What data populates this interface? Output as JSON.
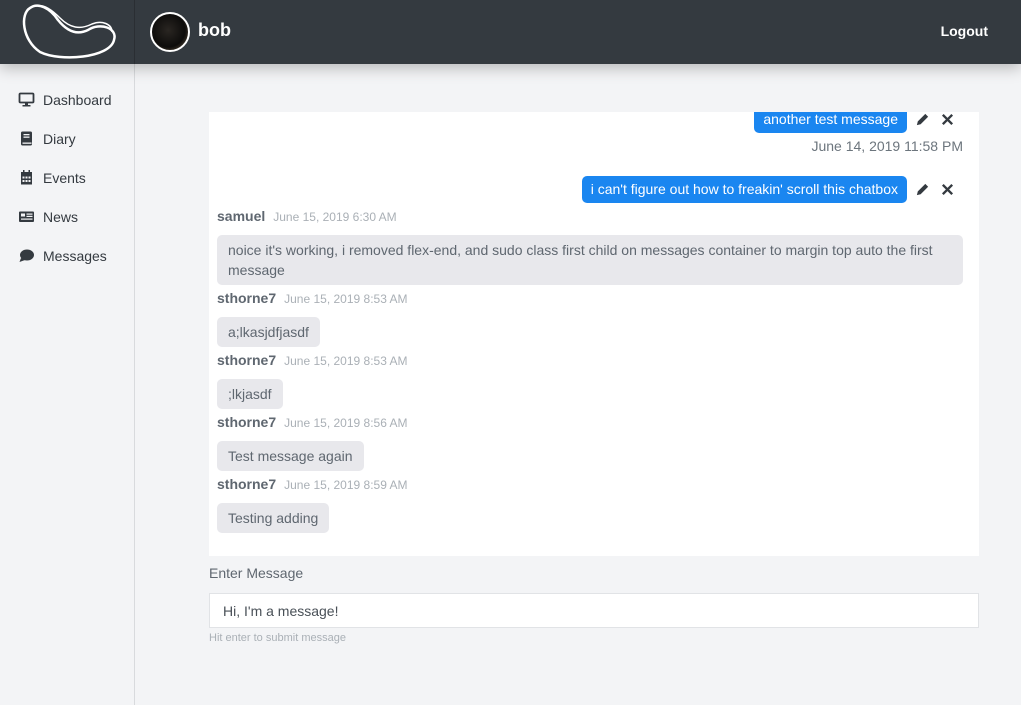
{
  "header": {
    "username": "bob",
    "logout_label": "Logout"
  },
  "sidebar": {
    "items": [
      {
        "label": "Dashboard",
        "icon": "desktop-icon"
      },
      {
        "label": "Diary",
        "icon": "book-icon"
      },
      {
        "label": "Events",
        "icon": "calendar-icon"
      },
      {
        "label": "News",
        "icon": "newspaper-icon"
      },
      {
        "label": "Messages",
        "icon": "comment-icon"
      }
    ]
  },
  "chat": {
    "sent": [
      {
        "text": "another test message",
        "time": "June 14, 2019 11:58 PM"
      },
      {
        "text": "i can't figure out how to freakin' scroll this chatbox"
      }
    ],
    "received": [
      {
        "name": "samuel",
        "time": "June 15, 2019 6:30 AM",
        "text": "noice it's working, i removed flex-end, and sudo class first child on messages container to margin top auto the first message"
      },
      {
        "name": "sthorne7",
        "time": "June 15, 2019 8:53 AM",
        "text": "a;lkasjdfjasdf"
      },
      {
        "name": "sthorne7",
        "time": "June 15, 2019 8:53 AM",
        "text": ";lkjasdf"
      },
      {
        "name": "sthorne7",
        "time": "June 15, 2019 8:56 AM",
        "text": "Test message again"
      },
      {
        "name": "sthorne7",
        "time": "June 15, 2019 8:59 AM",
        "text": "Testing adding"
      }
    ],
    "colors": {
      "sent_bubble": "#1a86f0",
      "received_bubble": "#e8e8ec"
    }
  },
  "composer": {
    "label": "Enter Message",
    "value": "Hi, I'm a message!",
    "help": "Hit enter to submit message"
  }
}
